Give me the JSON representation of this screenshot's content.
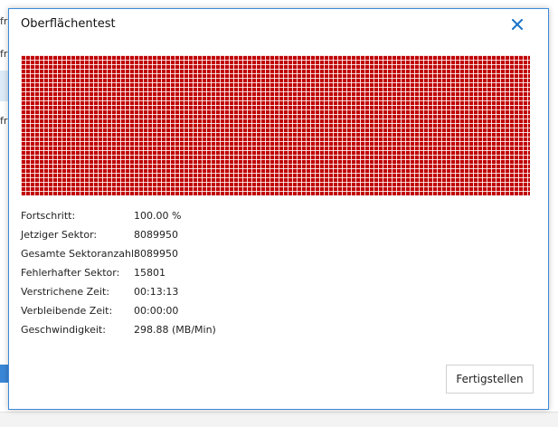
{
  "background": {
    "fragments": [
      "fr",
      "fr",
      "fr"
    ]
  },
  "dialog": {
    "title": "Oberflächentest",
    "close_icon": "close-icon",
    "grid_color": "#c00000",
    "stats": [
      {
        "label": "Fortschritt:",
        "value": "100.00 %"
      },
      {
        "label": "Jetziger Sektor:",
        "value": "8089950"
      },
      {
        "label": "Gesamte Sektoranzahl:",
        "value": "8089950"
      },
      {
        "label": "Fehlerhafter Sektor:",
        "value": "15801"
      },
      {
        "label": "Verstrichene Zeit:",
        "value": "00:13:13"
      },
      {
        "label": "Verbleibende Zeit:",
        "value": "00:00:00"
      },
      {
        "label": "Geschwindigkeit:",
        "value": "298.88 (MB/Min)"
      }
    ],
    "finish_label": "Fertigstellen"
  },
  "colors": {
    "accent": "#3c8ad8",
    "close_icon": "#1a73c8"
  }
}
